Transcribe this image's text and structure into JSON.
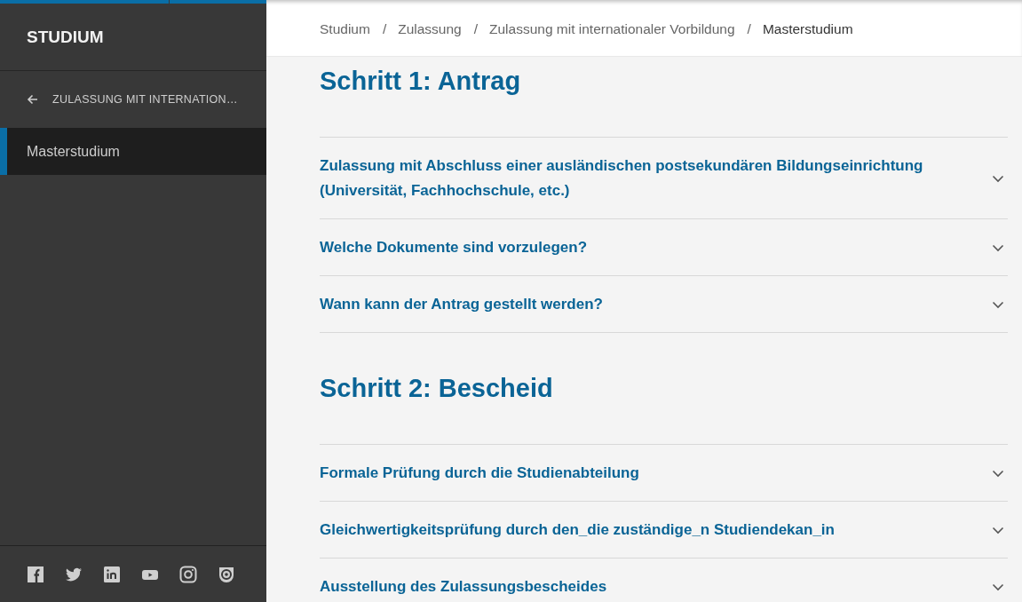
{
  "sidebar": {
    "title": "STUDIUM",
    "back_link": "ZULASSUNG MIT INTERNATION…",
    "items": [
      {
        "label": "Masterstudium",
        "selected": true
      }
    ]
  },
  "breadcrumb": [
    {
      "label": "Studium",
      "current": false
    },
    {
      "separator": "/",
      "label": "Zulassung",
      "current": false
    },
    {
      "separator": "/",
      "label": "Zulassung mit internationaler Vorbildung",
      "current": false
    },
    {
      "separator": "/",
      "label": "Masterstudium",
      "current": true
    }
  ],
  "sections": [
    {
      "heading": "Schritt 1: Antrag",
      "items": [
        {
          "label": "Zulassung mit Abschluss einer ausländischen postsekundären Bildungseinrichtung (Universität, Fachhochschule, etc.)",
          "expanded": false
        },
        {
          "label": "Welche Dokumente sind vorzulegen?",
          "expanded": false
        },
        {
          "label": "Wann kann der Antrag gestellt werden?",
          "expanded": false
        }
      ]
    },
    {
      "heading": "Schritt 2: Bescheid",
      "items": [
        {
          "label": "Formale Prüfung durch die Studienabteilung",
          "expanded": false
        },
        {
          "label": "Gleichwertigkeitsprüfung durch den_die zuständige_n Studiendekan_in",
          "expanded": false
        },
        {
          "label": "Ausstellung des Zulassungsbescheides",
          "expanded": false
        }
      ]
    }
  ]
}
